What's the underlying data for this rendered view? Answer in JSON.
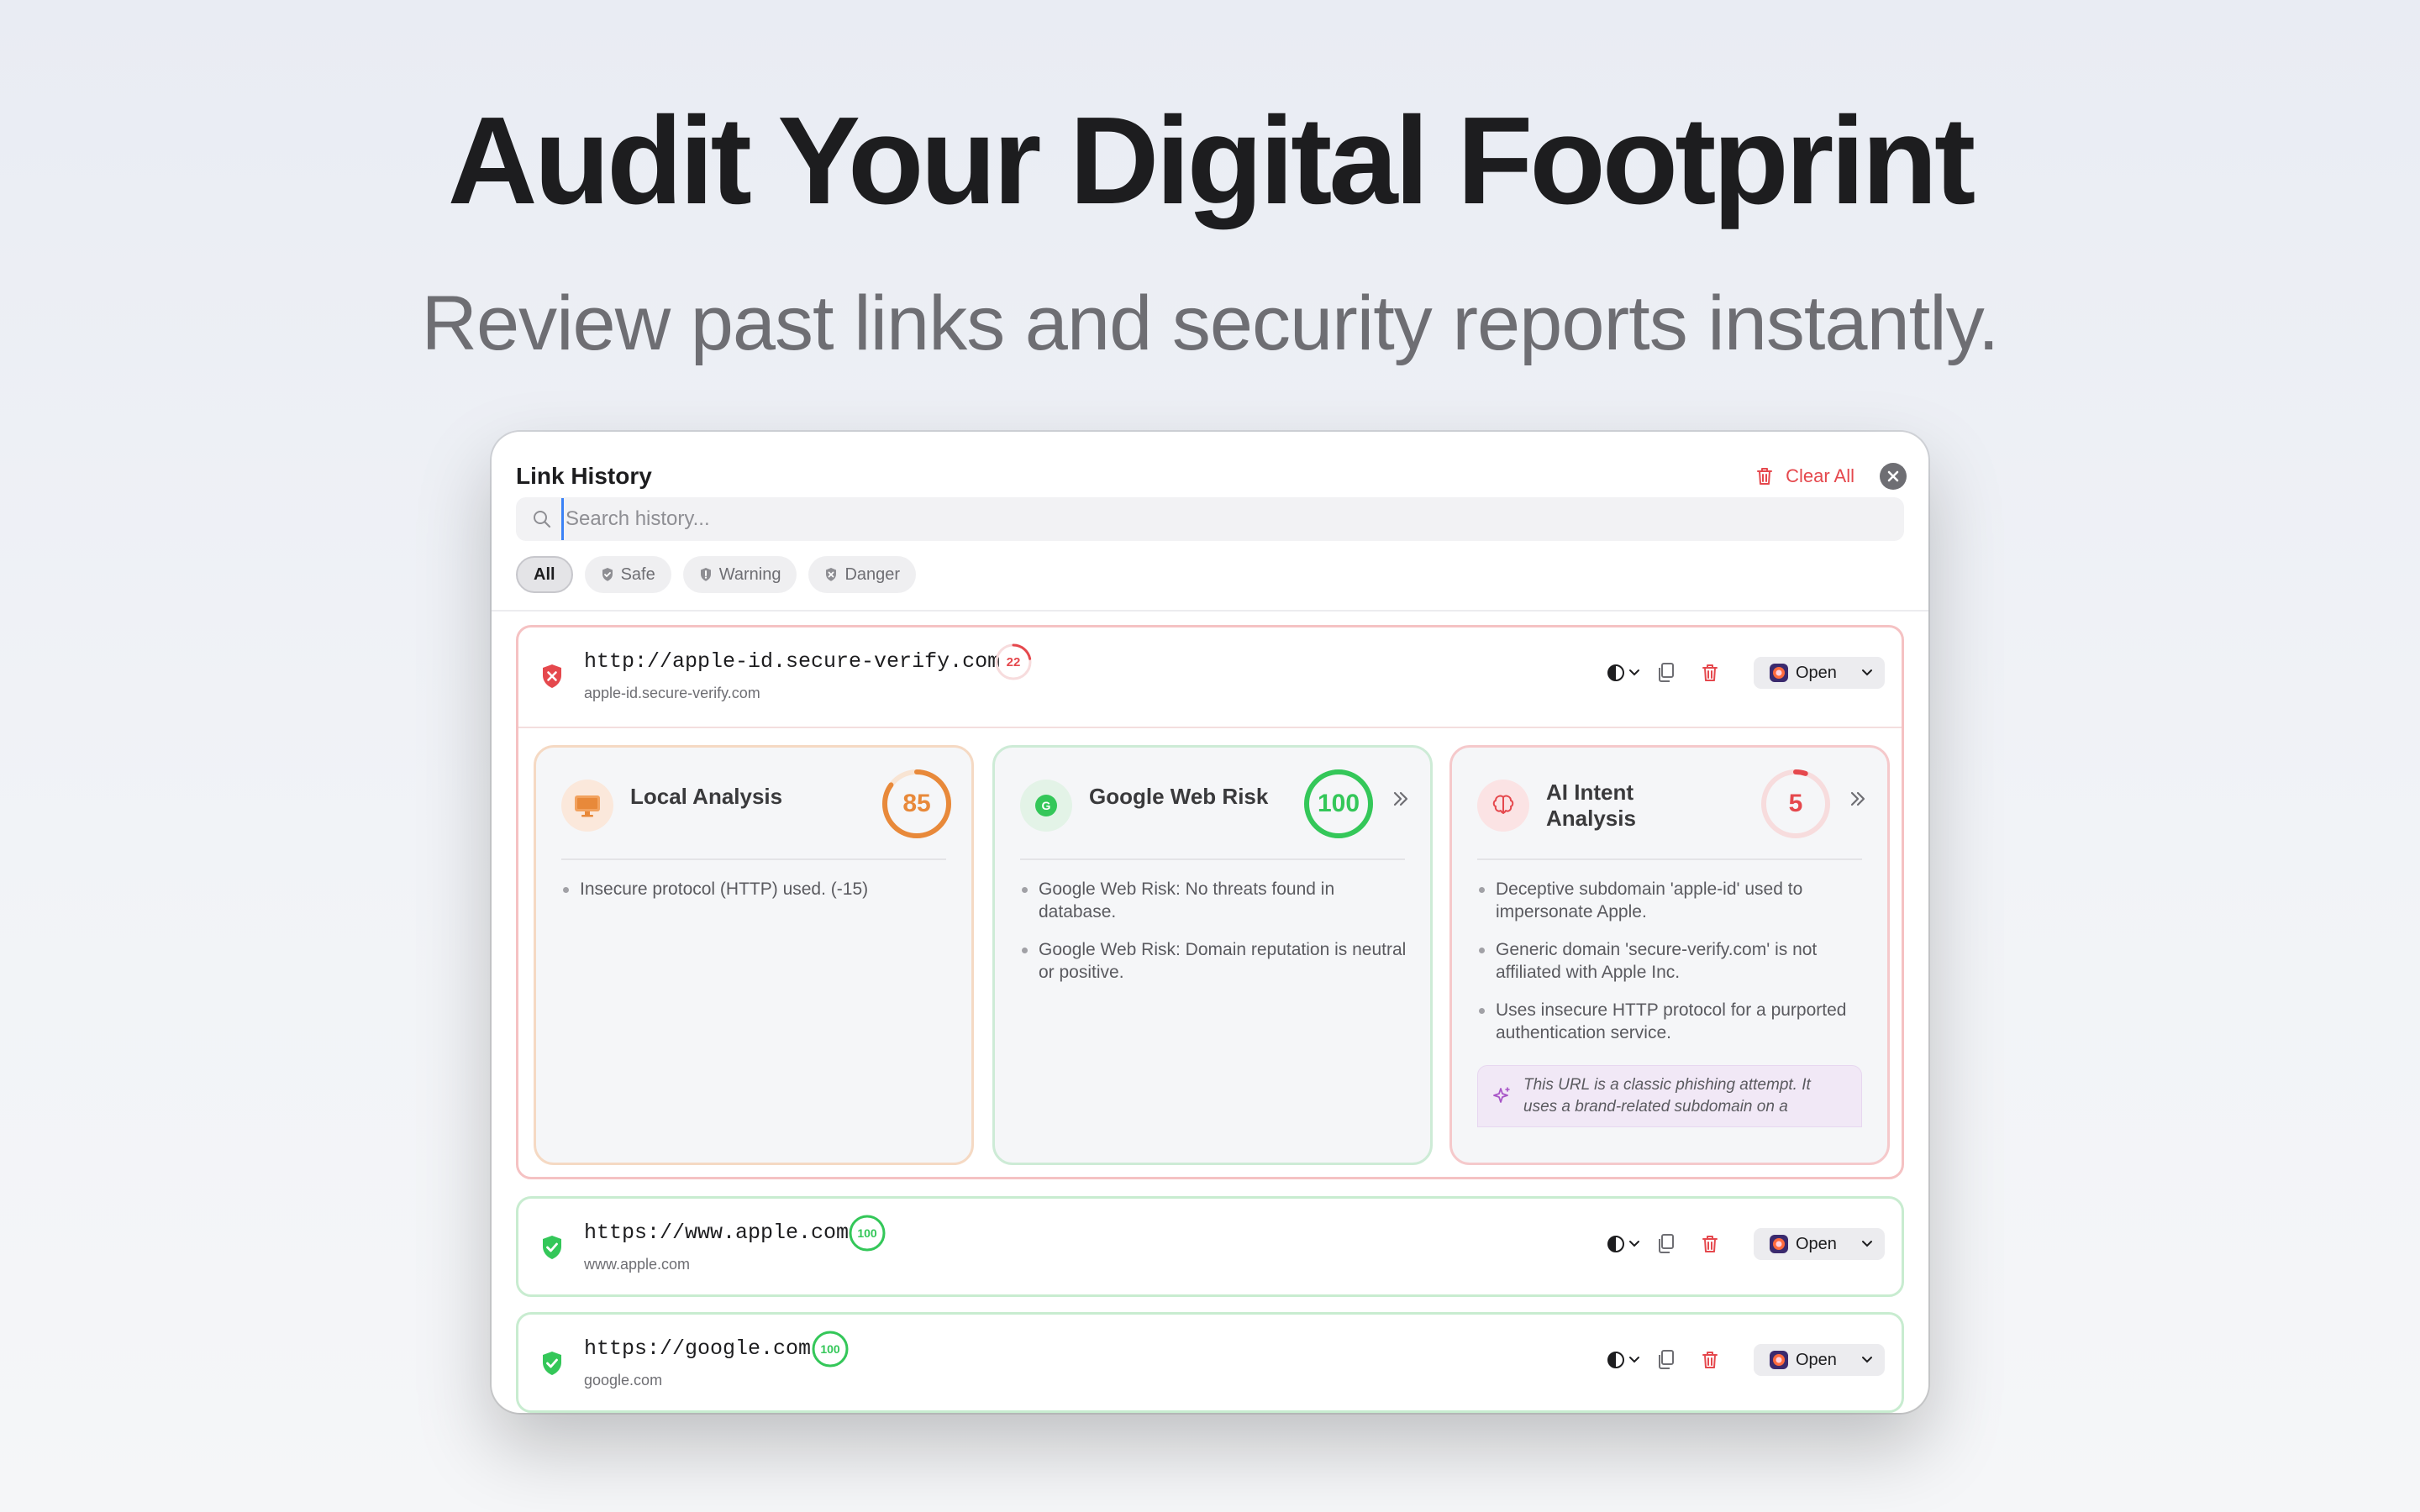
{
  "hero": {
    "headline": "Audit Your Digital Footprint",
    "subheadline": "Review past links and security reports instantly."
  },
  "window": {
    "title": "Link History",
    "clear_all_label": "Clear All"
  },
  "search": {
    "placeholder": "Search history...",
    "value": ""
  },
  "filters": [
    {
      "label": "All",
      "active": true
    },
    {
      "label": "Safe",
      "active": false
    },
    {
      "label": "Warning",
      "active": false
    },
    {
      "label": "Danger",
      "active": false
    }
  ],
  "entries": [
    {
      "status": "danger",
      "url": "http://apple-id.secure-verify.com",
      "domain": "apple-id.secure-verify.com",
      "score": "22",
      "score_value": 22,
      "open_label": "Open",
      "expanded": true,
      "cards": [
        {
          "title": "Local Analysis",
          "score": "85",
          "score_value": 85,
          "color": "#e8893a",
          "icon": "monitor-icon",
          "bullets": [
            "Insecure protocol (HTTP) used. (-15)"
          ]
        },
        {
          "title": "Google Web Risk",
          "score": "100",
          "score_value": 100,
          "color": "#34c759",
          "icon": "google-icon",
          "bullets": [
            "Google Web Risk: No threats found in database.",
            "Google Web Risk: Domain reputation is neutral or positive."
          ]
        },
        {
          "title": "AI Intent Analysis",
          "score": "5",
          "score_value": 5,
          "color": "#e5484d",
          "icon": "brain-icon",
          "bullets": [
            "Deceptive subdomain 'apple-id' used to impersonate Apple.",
            "Generic domain 'secure-verify.com' is not affiliated with Apple Inc.",
            "Uses insecure HTTP protocol for a purported authentication service."
          ],
          "summary": "This URL is a classic phishing attempt. It uses a brand-related subdomain on a"
        }
      ]
    },
    {
      "status": "safe",
      "url": "https://www.apple.com",
      "domain": "www.apple.com",
      "score": "100",
      "score_value": 100,
      "open_label": "Open"
    },
    {
      "status": "safe",
      "url": "https://google.com",
      "domain": "google.com",
      "score": "100",
      "score_value": 100,
      "open_label": "Open"
    }
  ],
  "colors": {
    "danger": "#e5484d",
    "safe": "#34c759",
    "warning": "#e8893a"
  }
}
